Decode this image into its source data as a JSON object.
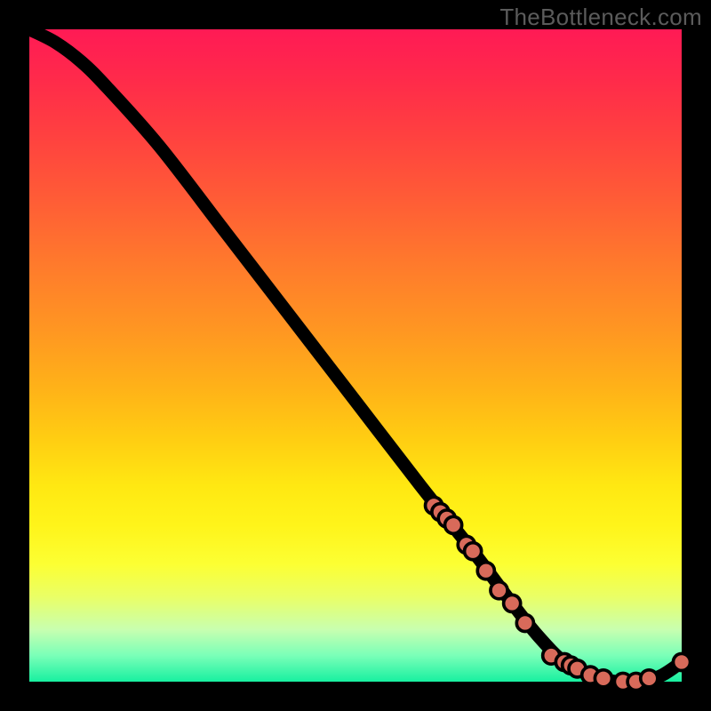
{
  "watermark": "TheBottleneck.com",
  "chart_data": {
    "type": "line",
    "title": "",
    "xlabel": "",
    "ylabel": "",
    "xlim": [
      0,
      100
    ],
    "ylim": [
      0,
      100
    ],
    "grid": false,
    "legend": false,
    "series": [
      {
        "name": "bottleneck-curve",
        "x": [
          0,
          4,
          8,
          12,
          20,
          30,
          40,
          50,
          60,
          68,
          74,
          78,
          82,
          86,
          90,
          94,
          97,
          100
        ],
        "y": [
          100,
          98,
          95,
          91,
          82,
          69,
          56,
          43,
          30,
          20,
          12,
          7,
          3,
          1,
          0,
          0,
          1,
          3
        ]
      }
    ],
    "markers": {
      "name": "highlighted-points",
      "color": "#d86a5a",
      "x": [
        62,
        63,
        64,
        65,
        67,
        68,
        70,
        72,
        74,
        76,
        80,
        82,
        83,
        84,
        86,
        88,
        91,
        93,
        95,
        100
      ],
      "y": [
        27,
        26,
        25,
        24,
        21,
        20,
        17,
        14,
        12,
        9,
        4,
        3,
        2.5,
        2,
        1,
        0.5,
        0,
        0,
        0.5,
        3
      ]
    },
    "background_gradient": {
      "direction": "vertical",
      "stops": [
        {
          "pos": 0.0,
          "color": "#ff1a55"
        },
        {
          "pos": 0.5,
          "color": "#ffb218"
        },
        {
          "pos": 0.82,
          "color": "#fcff33"
        },
        {
          "pos": 1.0,
          "color": "#18f0a0"
        }
      ]
    }
  }
}
